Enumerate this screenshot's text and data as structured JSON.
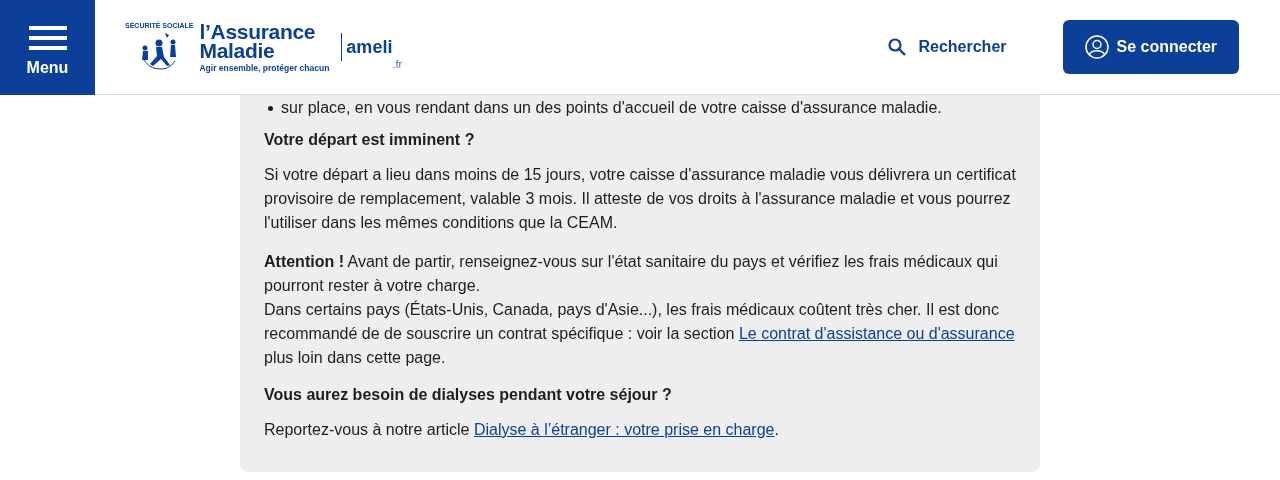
{
  "header": {
    "menu_button": {
      "label": "Menu"
    },
    "logo": {
      "seal_text": "SÉCURITÉ SOCIALE",
      "name_lines": [
        "l’Assurance",
        "Maladie"
      ],
      "tagline": "Agir ensemble, protéger chacun",
      "site": "ameli",
      "domain": ".fr"
    },
    "search_link": {
      "label": "Rechercher"
    },
    "login_button": {
      "label": "Se connecter"
    }
  },
  "content": [
    {
      "kind": "bullet",
      "segments": [
        {
          "kind": "text",
          "text": "sur place, en vous rendant dans un des points d'accueil de votre caisse d'assurance maladie."
        }
      ]
    },
    {
      "kind": "heading",
      "segments": [
        {
          "kind": "text",
          "text": "Votre départ est imminent ?"
        }
      ]
    },
    {
      "kind": "paragraph",
      "segments": [
        {
          "kind": "text",
          "text": "Si votre départ a lieu dans moins de 15 jours, votre caisse d'assurance maladie vous délivrera un certificat provisoire de remplacement, valable 3 mois. Il atteste de vos droits à l'assurance maladie et vous pourrez l'utiliser dans les mêmes conditions que la CEAM."
        }
      ]
    },
    {
      "kind": "paragraph",
      "segments": [
        {
          "kind": "text",
          "text": "**Attention !** Avant de partir, renseignez-vous sur l'état sanitaire du pays et vérifiez les frais médicaux qui pourront rester à votre charge."
        },
        {
          "kind": "break"
        },
        {
          "kind": "text",
          "text": "Dans certains pays (États-Unis, Canada, pays d'Asie...), les frais médicaux coûtent très cher. Il est donc recommandé de de souscrire un contrat spécifique : voir la section"
        },
        {
          "kind": "link",
          "text": "Le contrat d'assistance ou d'assurance"
        },
        {
          "kind": "text",
          "text": "plus loin dans cette page."
        }
      ]
    },
    {
      "kind": "heading",
      "segments": [
        {
          "kind": "text",
          "text": "Vous aurez besoin de dialyses pendant votre séjour ?"
        }
      ]
    },
    {
      "kind": "paragraph",
      "segments": [
        {
          "kind": "text",
          "text": "Reportez-vous à notre article"
        },
        {
          "kind": "link",
          "text": "Dialyse à l’étranger : votre prise en charge"
        },
        {
          "kind": "text",
          "text": "."
        }
      ]
    }
  ]
}
